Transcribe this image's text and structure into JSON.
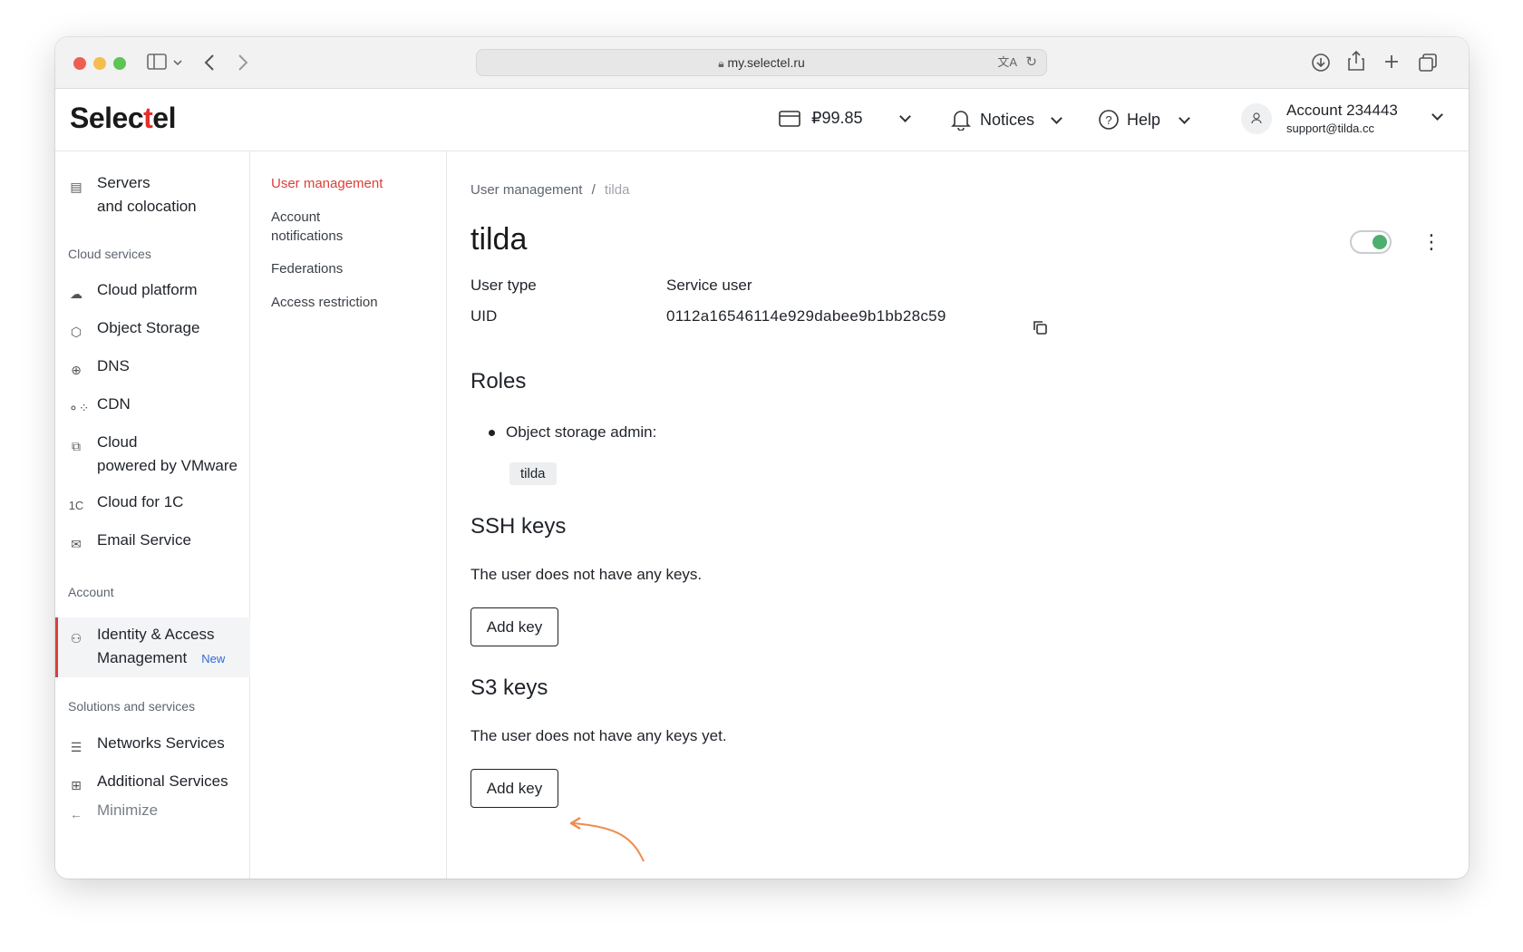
{
  "browser": {
    "url": "my.selectel.ru"
  },
  "header": {
    "logo_left": "Selec",
    "logo_red": "t",
    "logo_right": "el",
    "balance": "₽99.85",
    "notices": "Notices",
    "help": "Help",
    "account_name": "Account 234443",
    "account_email": "support@tilda.cc"
  },
  "sidebar": {
    "servers_line1": "Servers",
    "servers_line2": "and colocation",
    "section_cloud": "Cloud services",
    "cloud_platform": "Cloud platform",
    "object_storage": "Object Storage",
    "dns": "DNS",
    "cdn": "CDN",
    "vmware_line1": "Cloud",
    "vmware_line2": "powered by VMware",
    "cloud_1c_icon": "1C",
    "cloud_1c": "Cloud for 1C",
    "email_service": "Email Service",
    "section_account": "Account",
    "iam_line1": "Identity & Access",
    "iam_line2": "Management",
    "iam_badge": "New",
    "section_solutions": "Solutions and services",
    "networks": "Networks Services",
    "additional": "Additional Services",
    "minimize": "Minimize"
  },
  "subnav": {
    "user_management": "User management",
    "notifications_line1": "Account",
    "notifications_line2": "notifications",
    "federations": "Federations",
    "access_restriction": "Access restriction"
  },
  "main": {
    "breadcrumb_parent": "User management",
    "breadcrumb_sep": "/",
    "breadcrumb_current": "tilda",
    "title": "tilda",
    "user_type_label": "User type",
    "user_type_value": "Service user",
    "uid_label": "UID",
    "uid_value": "0112a16546114e929dabee9b1bb28c59",
    "roles_heading": "Roles",
    "role_name": "Object storage admin:",
    "role_tag": "tilda",
    "ssh_heading": "SSH keys",
    "ssh_empty": "The user does not have any keys.",
    "ssh_add": "Add key",
    "s3_heading": "S3 keys",
    "s3_empty": "The user does not have any keys yet.",
    "s3_add": "Add key"
  },
  "colors": {
    "brand_red": "#e4312b",
    "active_red": "#d9403a",
    "toggle_green": "#4caf6e",
    "arrow_orange": "#f08a4b",
    "badge_blue": "#2f6bd6"
  }
}
